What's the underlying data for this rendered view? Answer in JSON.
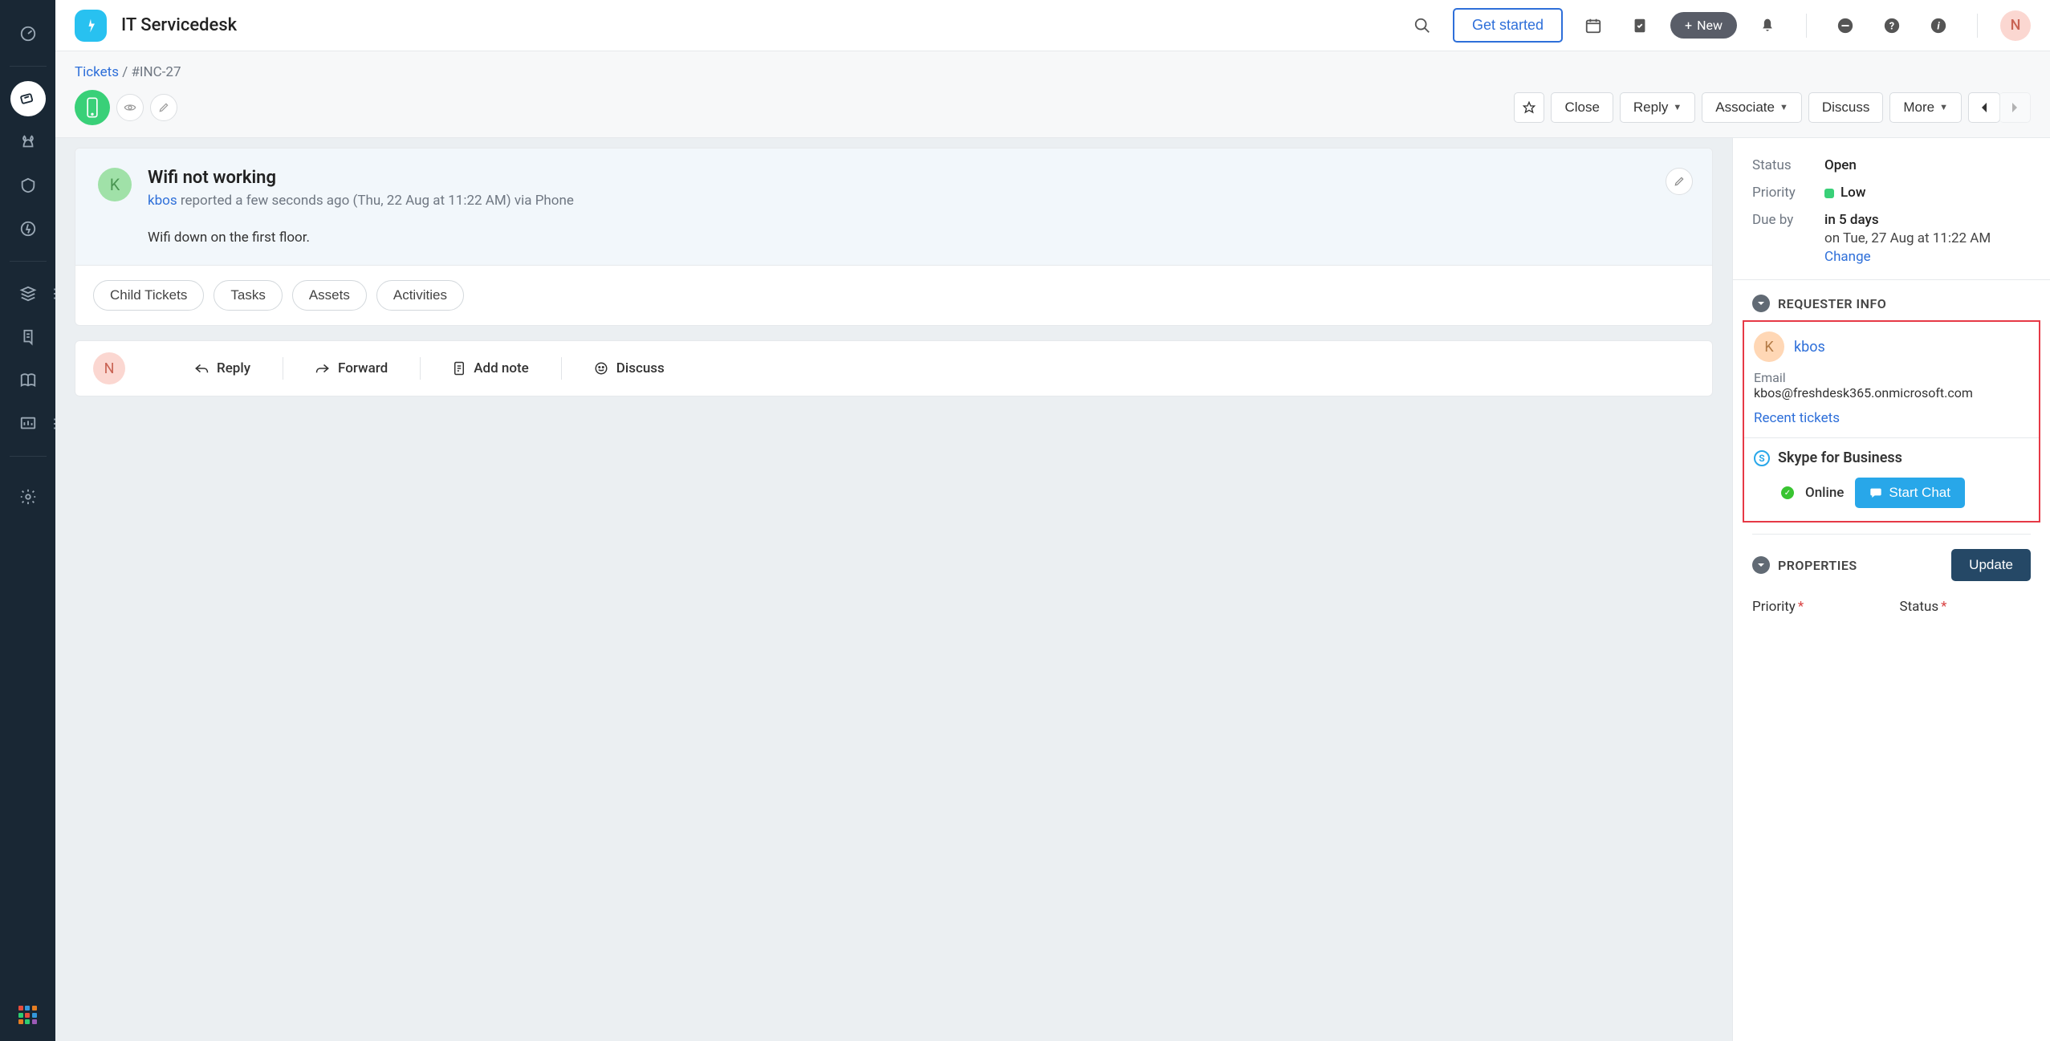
{
  "app": {
    "title": "IT Servicedesk"
  },
  "header": {
    "get_started": "Get started",
    "new_label": "New",
    "user_initial": "N"
  },
  "breadcrumb": {
    "root": "Tickets",
    "ticket_id": "#INC-27"
  },
  "actions": {
    "close": "Close",
    "reply": "Reply",
    "associate": "Associate",
    "discuss": "Discuss",
    "more": "More"
  },
  "ticket": {
    "avatar_initial": "K",
    "title": "Wifi not working",
    "reporter": "kbos",
    "meta_text": "reported a few seconds ago (Thu, 22 Aug at 11:22 AM) via Phone",
    "body": "Wifi down on the first floor."
  },
  "tabs": {
    "child": "Child Tickets",
    "tasks": "Tasks",
    "assets": "Assets",
    "activities": "Activities"
  },
  "reply_bar": {
    "avatar": "N",
    "reply": "Reply",
    "forward": "Forward",
    "add_note": "Add note",
    "discuss": "Discuss"
  },
  "status_panel": {
    "status_label": "Status",
    "status_value": "Open",
    "priority_label": "Priority",
    "priority_value": "Low",
    "priority_color": "#39d078",
    "due_label": "Due by",
    "due_value": "in 5 days",
    "due_date": "on Tue, 27 Aug at 11:22 AM",
    "change": "Change"
  },
  "requester": {
    "section_title": "REQUESTER INFO",
    "avatar_initial": "K",
    "name": "kbos",
    "email_label": "Email",
    "email": "kbos@freshdesk365.onmicrosoft.com",
    "recent_tickets": "Recent tickets",
    "skype_label": "Skype for Business",
    "online": "Online",
    "start_chat": "Start Chat"
  },
  "properties": {
    "section_title": "PROPERTIES",
    "update": "Update",
    "priority_field": "Priority",
    "status_field": "Status"
  }
}
